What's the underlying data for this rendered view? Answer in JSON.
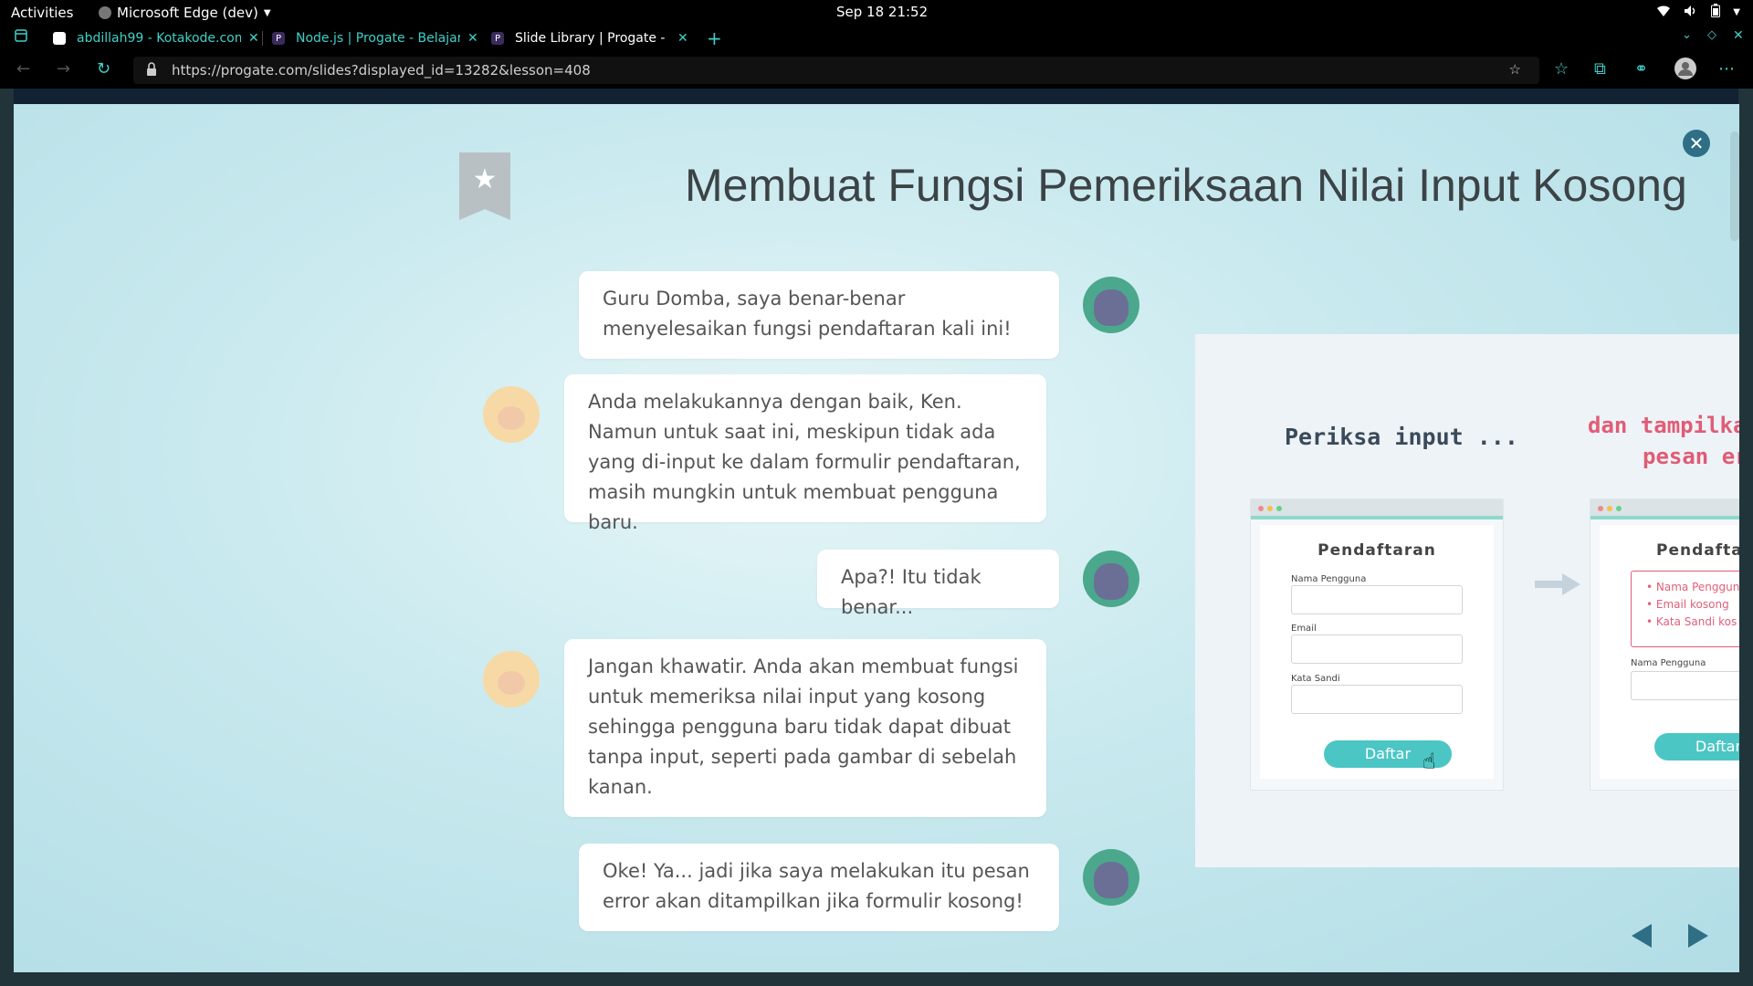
{
  "system": {
    "activities": "Activities",
    "app_name": "Microsoft Edge (dev)",
    "clock": "Sep 18  21:52"
  },
  "tabs": [
    {
      "title": "abdillah99 - Kotakode.com",
      "icon": "kotakode-favicon"
    },
    {
      "title": "Node.js | Progate - Belajar",
      "icon": "progate-favicon"
    },
    {
      "title": "Slide Library | Progate - B",
      "icon": "progate-favicon"
    }
  ],
  "address_bar": {
    "url": "https://progate.com/slides?displayed_id=13282&lesson=408"
  },
  "slide": {
    "title": "Membuat Fungsi Pemeriksaan Nilai Input Kosong",
    "dialogue": [
      {
        "speaker": "ken",
        "text": "Guru Domba, saya benar-benar menyelesaikan fungsi pendaftaran kali ini!"
      },
      {
        "speaker": "sheep",
        "text": "Anda melakukannya dengan baik, Ken. Namun untuk saat ini, meskipun tidak ada yang di-input ke dalam formulir pendaftaran, masih mungkin untuk membuat pengguna baru."
      },
      {
        "speaker": "ken",
        "text": "Apa?! Itu tidak benar..."
      },
      {
        "speaker": "sheep",
        "text": "Jangan khawatir. Anda akan membuat fungsi untuk memeriksa nilai input yang kosong sehingga pengguna baru tidak dapat dibuat tanpa input, seperti pada gambar di sebelah kanan."
      },
      {
        "speaker": "ken",
        "text": "Oke! Ya... jadi jika saya melakukan itu pesan error akan ditampilkan jika formulir kosong!"
      }
    ],
    "illustration": {
      "left_heading": "Periksa input ...",
      "right_heading_line1": "dan tampilka",
      "right_heading_line2": "pesan er",
      "form_title": "Pendaftaran",
      "form_title_cut": "Pendaftar",
      "label_username": "Nama Pengguna",
      "label_email": "Email",
      "label_password": "Kata Sandi",
      "button_label": "Daftar",
      "errors": [
        "• Nama Penggun",
        "• Email kosong",
        "• Kata Sandi kos"
      ]
    }
  }
}
